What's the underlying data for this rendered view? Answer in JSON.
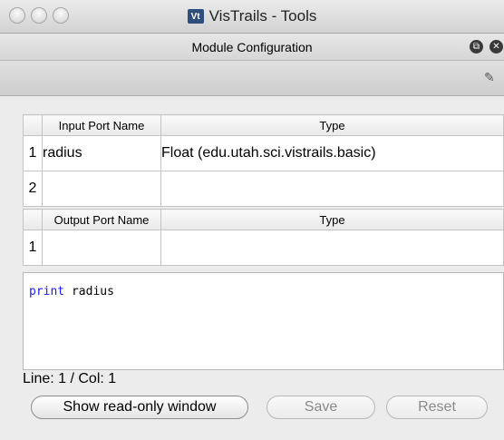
{
  "window": {
    "title": "VisTrails - Tools",
    "app_icon": "Vt"
  },
  "panel": {
    "title": "Module Configuration"
  },
  "input_table": {
    "headers": [
      "Input Port Name",
      "Type"
    ],
    "rows": [
      {
        "num": "1",
        "name": "radius",
        "type": "Float (edu.utah.sci.vistrails.basic)"
      },
      {
        "num": "2",
        "name": "",
        "type": ""
      }
    ]
  },
  "output_table": {
    "headers": [
      "Output Port Name",
      "Type"
    ],
    "rows": [
      {
        "num": "1",
        "name": "",
        "type": ""
      }
    ]
  },
  "editor": {
    "keyword": "print",
    "rest": " radius"
  },
  "status": {
    "text": "Line: 1 / Col: 1"
  },
  "buttons": {
    "show_readonly": "Show read-only window",
    "save": "Save",
    "reset": "Reset"
  }
}
